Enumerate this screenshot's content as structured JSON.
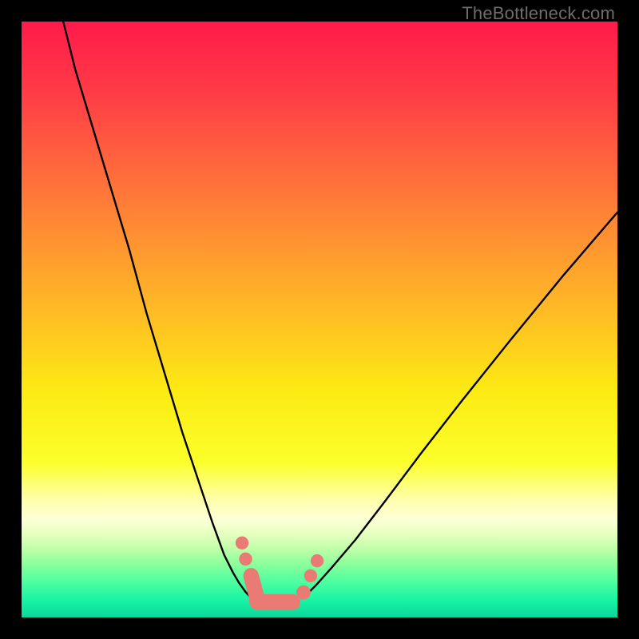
{
  "watermark": "TheBottleneck.com",
  "chart_data": {
    "type": "line",
    "title": "",
    "xlabel": "",
    "ylabel": "",
    "xlim": [
      0,
      100
    ],
    "ylim": [
      0,
      100
    ],
    "grid": false,
    "legend": false,
    "background_gradient": {
      "stops": [
        {
          "offset": 0.0,
          "color": "#ff1a4b"
        },
        {
          "offset": 0.13,
          "color": "#ff3f46"
        },
        {
          "offset": 0.3,
          "color": "#ff7b38"
        },
        {
          "offset": 0.48,
          "color": "#ffb926"
        },
        {
          "offset": 0.62,
          "color": "#fcea13"
        },
        {
          "offset": 0.74,
          "color": "#fbff2a"
        },
        {
          "offset": 0.8,
          "color": "#ffffa8"
        },
        {
          "offset": 0.835,
          "color": "#fdffd7"
        },
        {
          "offset": 0.86,
          "color": "#e6ffc0"
        },
        {
          "offset": 0.885,
          "color": "#bfffa8"
        },
        {
          "offset": 0.91,
          "color": "#8cff9c"
        },
        {
          "offset": 0.94,
          "color": "#4effa0"
        },
        {
          "offset": 0.972,
          "color": "#17f3a4"
        },
        {
          "offset": 1.0,
          "color": "#0cd69b"
        }
      ]
    },
    "series": [
      {
        "name": "curve-left",
        "x": [
          7,
          9,
          12,
          15,
          18,
          21,
          24,
          27,
          30,
          32,
          34,
          35.5,
          36.5,
          37.5,
          38.2,
          39.0
        ],
        "y": [
          100,
          92,
          82,
          72,
          62,
          51,
          41,
          31,
          22,
          16,
          10.5,
          7.5,
          5.8,
          4.4,
          3.6,
          3.2
        ]
      },
      {
        "name": "curve-right",
        "x": [
          47.0,
          48.0,
          49.5,
          52,
          56,
          61,
          67,
          74,
          82,
          91,
          100
        ],
        "y": [
          3.2,
          4.0,
          5.5,
          8.3,
          13.0,
          19.5,
          27.5,
          36.5,
          46.5,
          57.5,
          68.0
        ]
      },
      {
        "name": "valley-markers",
        "markers": [
          {
            "kind": "circle",
            "cx": 37.6,
            "cy": 9.8,
            "r": 1.1
          },
          {
            "kind": "circle",
            "cx": 37.0,
            "cy": 12.5,
            "r": 1.1
          },
          {
            "kind": "pill",
            "x1": 38.5,
            "y1": 7.0,
            "x2": 39.5,
            "y2": 3.3,
            "r": 1.3
          },
          {
            "kind": "pill",
            "x1": 39.5,
            "y1": 2.6,
            "x2": 45.5,
            "y2": 2.6,
            "r": 1.3
          },
          {
            "kind": "circle",
            "cx": 47.3,
            "cy": 4.2,
            "r": 1.2
          },
          {
            "kind": "circle",
            "cx": 48.5,
            "cy": 7.0,
            "r": 1.1
          },
          {
            "kind": "circle",
            "cx": 49.6,
            "cy": 9.5,
            "r": 1.1
          }
        ]
      }
    ]
  }
}
